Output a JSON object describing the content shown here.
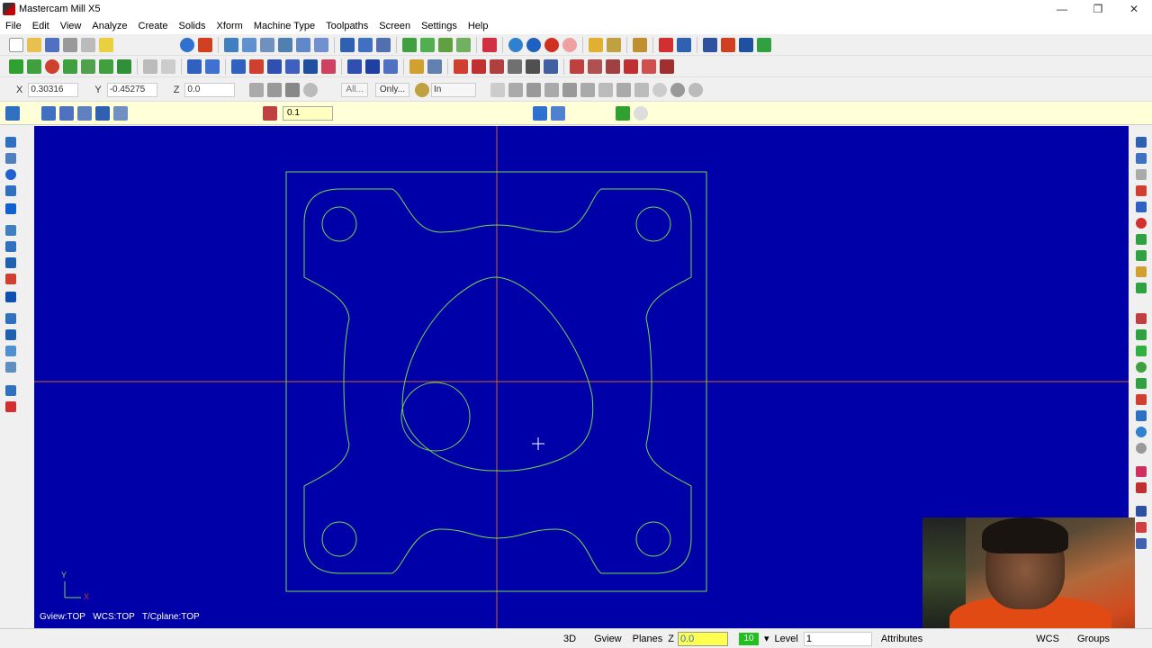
{
  "window": {
    "title": "Mastercam Mill X5"
  },
  "menu": [
    "File",
    "Edit",
    "View",
    "Analyze",
    "Create",
    "Solids",
    "Xform",
    "Machine Type",
    "Toolpaths",
    "Screen",
    "Settings",
    "Help"
  ],
  "ribbon": {
    "x_label": "X",
    "x_value": "0.30316",
    "y_label": "Y",
    "y_value": "-0.45275",
    "z_label": "Z",
    "z_value": "0.0",
    "all_btn": "All...",
    "only_btn": "Only...",
    "unit": "In"
  },
  "ribbon2": {
    "value": "0.1"
  },
  "viewport": {
    "info": {
      "gview": "Gview:TOP",
      "wcs": "WCS:TOP",
      "tcplane": "T/Cplane:TOP"
    },
    "axis_x": "X",
    "axis_y": "Y",
    "bg_color": "#0000a8",
    "geometry_color": "#6edc4a",
    "axis_h_color": "#d2601a"
  },
  "status": {
    "mode": "3D",
    "gview": "Gview",
    "planes": "Planes",
    "z_label": "Z",
    "z_value": "0.0",
    "color_num": "10",
    "level_label": "Level",
    "level_value": "1",
    "attributes": "Attributes",
    "wcs": "WCS",
    "groups": "Groups"
  }
}
